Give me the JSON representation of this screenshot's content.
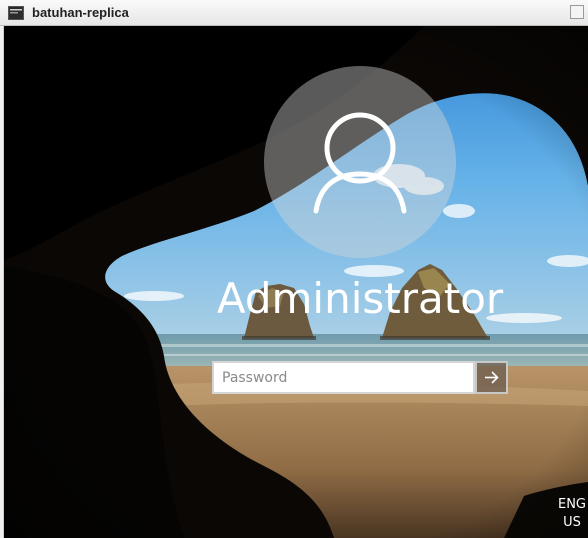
{
  "window": {
    "title": "batuhan-replica",
    "icon": "terminal-window-icon"
  },
  "login": {
    "avatar_icon": "user-silhouette-icon",
    "username": "Administrator",
    "password_placeholder": "Password",
    "password_value": "",
    "submit_icon": "arrow-right-icon"
  },
  "language": {
    "line1": "ENG",
    "line2": "US"
  },
  "colors": {
    "sky": "#5aa6e0",
    "sea": "#7aa9b8",
    "sand": "#a9875e",
    "cave": "#0b0805",
    "input_border": "#d5d5d5"
  }
}
